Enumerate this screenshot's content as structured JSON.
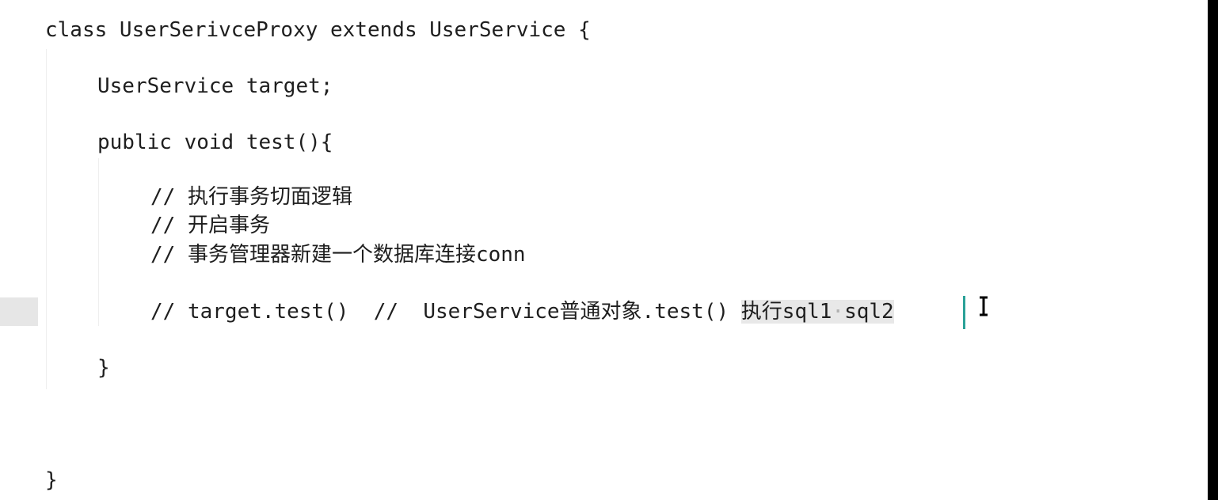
{
  "editor": {
    "lines": {
      "class_decl": "class UserSerivceProxy extends UserService {",
      "field_decl": "UserService target;",
      "method_decl": "public void test(){",
      "comment_1": "// 执行事务切面逻辑",
      "comment_2": "// 开启事务",
      "comment_3": "// 事务管理器新建一个数据库连接conn",
      "comment_4_code": "// target.test()  //  UserService普通对象.test() ",
      "comment_4_sel_a": "执行sql1",
      "comment_4_sel_dot": "·",
      "comment_4_sel_b": "sql2",
      "method_close": "}",
      "class_close": "}"
    },
    "colors": {
      "text": "#1e1e1e",
      "background": "#ffffff",
      "selection": "#e8e8e8",
      "caret": "#2aa198",
      "current_line_gutter": "#e6e6e6"
    }
  }
}
